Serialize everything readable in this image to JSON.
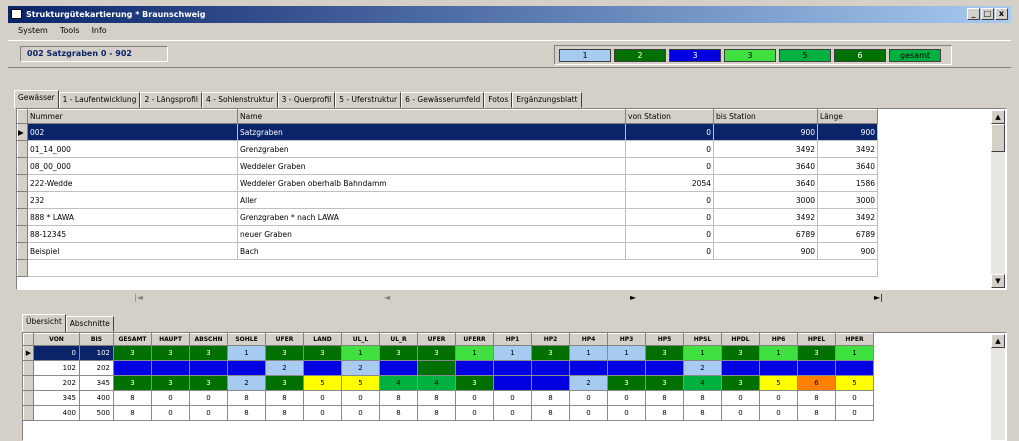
{
  "window": {
    "title": "Strukturgütekartierung * Braunschweig",
    "min": "_",
    "max": "□",
    "close": "x"
  },
  "menu": [
    "System",
    "Tools",
    "Info"
  ],
  "record_label": "002 Satzgraben 0 - 902",
  "legend": {
    "items": [
      {
        "label": "1",
        "color": "#a6caf0"
      },
      {
        "label": "2",
        "color": "#007000"
      },
      {
        "label": "3",
        "color": "#0000e0"
      },
      {
        "label": "3",
        "color": "#40e040"
      },
      {
        "label": "5",
        "color": "#00b040"
      },
      {
        "label": "6",
        "color": "#007000"
      },
      {
        "label": "gesamt",
        "color": "#00b040"
      }
    ]
  },
  "tabs": [
    "Gewässer",
    "1 - Laufentwicklung",
    "2 - Längsprofil",
    "4 - Sohlenstruktur",
    "3 - Querprofil",
    "5 - Uferstruktur",
    "6 - Gewässerumfeld",
    "Fotos",
    "Ergänzungsblatt"
  ],
  "table": {
    "headers": [
      "Nummer",
      "Name",
      "von Station",
      "bis Station",
      "Länge"
    ],
    "rows": [
      [
        "002",
        "Satzgraben",
        "0",
        "900",
        "900"
      ],
      [
        "01_14_000",
        "Grenzgraben",
        "0",
        "3492",
        "3492"
      ],
      [
        "08_00_000",
        "Weddeler Graben",
        "0",
        "3640",
        "3640"
      ],
      [
        "222-Wedde",
        "Weddeler Graben oberhalb Bahndamm",
        "2054",
        "3640",
        "1586"
      ],
      [
        "232",
        "Aller",
        "0",
        "3000",
        "3000"
      ],
      [
        "888 * LAWA",
        "Grenzgraben * nach LAWA",
        "0",
        "3492",
        "3492"
      ],
      [
        "88-12345",
        "neuer Graben",
        "0",
        "6789",
        "6789"
      ],
      [
        "Beispiel",
        "Bach",
        "0",
        "900",
        "900"
      ]
    ]
  },
  "nav": {
    "first": "|◄",
    "prev": "◄",
    "next": "►",
    "last": "►|"
  },
  "subtabs": [
    "Übersicht",
    "Abschnitte"
  ],
  "summary": {
    "headers": [
      "VON",
      "BIS",
      "GESAMT",
      "HAUPT",
      "ABSCHN",
      "SOHLE",
      "UFER",
      "LAND",
      "UL_L",
      "UL_R",
      "UFER",
      "UFERR",
      "HP1",
      "HP2",
      "HP4",
      "HP3",
      "HP5",
      "HPSL",
      "HPDL",
      "HP6",
      "HPEL",
      "HPER"
    ],
    "rows": [
      {
        "von": "0",
        "bis": "102",
        "cells": [
          [
            "3",
            "c2"
          ],
          [
            "3",
            "c2"
          ],
          [
            "3",
            "c2"
          ],
          [
            "1",
            "c1"
          ],
          [
            "3",
            "c2"
          ],
          [
            "3",
            "c2"
          ],
          [
            "1",
            "c3"
          ],
          [
            "3",
            "c2"
          ],
          [
            "3",
            "c2"
          ],
          [
            "1",
            "c3"
          ],
          [
            "1",
            "c1"
          ],
          [
            "3",
            "c2"
          ],
          [
            "1",
            "c1"
          ],
          [
            "1",
            "c1"
          ],
          [
            "3",
            "c2"
          ],
          [
            "1",
            "c3"
          ],
          [
            "3",
            "c2"
          ],
          [
            "1",
            "c3"
          ],
          [
            "3",
            "c2"
          ],
          [
            "1",
            "c3"
          ]
        ]
      },
      {
        "von": "102",
        "bis": "202",
        "cells": [
          [
            "",
            "c4"
          ],
          [
            "",
            "c4"
          ],
          [
            "",
            "c4"
          ],
          [
            "",
            "c4"
          ],
          [
            "2",
            "c1"
          ],
          [
            "",
            "c4"
          ],
          [
            "2",
            "c1"
          ],
          [
            "",
            "c4"
          ],
          [
            "",
            "c2"
          ],
          [
            "",
            "c4"
          ],
          [
            "",
            "c4"
          ],
          [
            "",
            "c4"
          ],
          [
            "",
            "c4"
          ],
          [
            "",
            "c4"
          ],
          [
            "",
            "c4"
          ],
          [
            "2",
            "c1"
          ],
          [
            "",
            "c4"
          ],
          [
            "",
            "c4"
          ],
          [
            "",
            "c4"
          ],
          [
            "",
            "c4"
          ]
        ]
      },
      {
        "von": "202",
        "bis": "345",
        "cells": [
          [
            "3",
            "c2"
          ],
          [
            "3",
            "c2"
          ],
          [
            "3",
            "c2"
          ],
          [
            "2",
            "c1"
          ],
          [
            "3",
            "c2"
          ],
          [
            "5",
            "c5"
          ],
          [
            "5",
            "c5"
          ],
          [
            "4",
            "c7"
          ],
          [
            "4",
            "c7"
          ],
          [
            "3",
            "c2"
          ],
          [
            "",
            "c4"
          ],
          [
            "",
            "c4"
          ],
          [
            "2",
            "c1"
          ],
          [
            "3",
            "c2"
          ],
          [
            "3",
            "c2"
          ],
          [
            "4",
            "c7"
          ],
          [
            "3",
            "c2"
          ],
          [
            "5",
            "c5"
          ],
          [
            "6",
            "c6"
          ],
          [
            "5",
            "c5"
          ]
        ]
      },
      {
        "von": "345",
        "bis": "400",
        "cells": [
          [
            "8",
            "cw"
          ],
          [
            "0",
            "cw"
          ],
          [
            "0",
            "cw"
          ],
          [
            "8",
            "cw"
          ],
          [
            "8",
            "cw"
          ],
          [
            "0",
            "cw"
          ],
          [
            "0",
            "cw"
          ],
          [
            "8",
            "cw"
          ],
          [
            "8",
            "cw"
          ],
          [
            "0",
            "cw"
          ],
          [
            "0",
            "cw"
          ],
          [
            "8",
            "cw"
          ],
          [
            "0",
            "cw"
          ],
          [
            "0",
            "cw"
          ],
          [
            "8",
            "cw"
          ],
          [
            "8",
            "cw"
          ],
          [
            "0",
            "cw"
          ],
          [
            "0",
            "cw"
          ],
          [
            "8",
            "cw"
          ],
          [
            "0",
            "cw"
          ]
        ]
      },
      {
        "von": "400",
        "bis": "500",
        "cells": [
          [
            "8",
            "cw"
          ],
          [
            "0",
            "cw"
          ],
          [
            "0",
            "cw"
          ],
          [
            "8",
            "cw"
          ],
          [
            "8",
            "cw"
          ],
          [
            "0",
            "cw"
          ],
          [
            "0",
            "cw"
          ],
          [
            "8",
            "cw"
          ],
          [
            "8",
            "cw"
          ],
          [
            "0",
            "cw"
          ],
          [
            "0",
            "cw"
          ],
          [
            "8",
            "cw"
          ],
          [
            "0",
            "cw"
          ],
          [
            "0",
            "cw"
          ],
          [
            "8",
            "cw"
          ],
          [
            "8",
            "cw"
          ],
          [
            "0",
            "cw"
          ],
          [
            "0",
            "cw"
          ],
          [
            "8",
            "cw"
          ],
          [
            "0",
            "cw"
          ]
        ]
      }
    ]
  }
}
